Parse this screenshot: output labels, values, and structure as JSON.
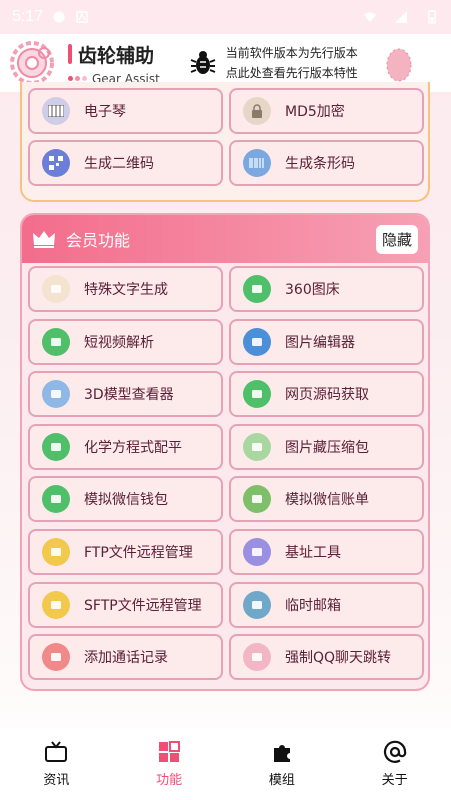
{
  "status": {
    "time": "5:17"
  },
  "header": {
    "title": "齿轮辅助",
    "subtitle": "Gear Assist",
    "notice_line1": "当前软件版本为先行版本",
    "notice_line2": "点此处查看先行版本特性"
  },
  "top_items": [
    {
      "label": "电子琴",
      "icon": "piano-icon"
    },
    {
      "label": "MD5加密",
      "icon": "lock-icon"
    },
    {
      "label": "生成二维码",
      "icon": "qrcode-icon"
    },
    {
      "label": "生成条形码",
      "icon": "barcode-icon"
    }
  ],
  "member": {
    "title": "会员功能",
    "hide_label": "隐藏",
    "items": [
      {
        "label": "特殊文字生成",
        "icon": "text-icon",
        "color": "#f3e3cf"
      },
      {
        "label": "360图床",
        "icon": "refresh-icon",
        "color": "#4fbf6a"
      },
      {
        "label": "短视频解析",
        "icon": "video-icon",
        "color": "#4fbf6a"
      },
      {
        "label": "图片编辑器",
        "icon": "folder-icon",
        "color": "#4a8fd8"
      },
      {
        "label": "3D模型查看器",
        "icon": "cube-icon",
        "color": "#8fb8e6"
      },
      {
        "label": "网页源码获取",
        "icon": "link-icon",
        "color": "#4fbf6a"
      },
      {
        "label": "化学方程式配平",
        "icon": "molecule-icon",
        "color": "#4fbf6a"
      },
      {
        "label": "图片藏压缩包",
        "icon": "archive-icon",
        "color": "#a8d8a0"
      },
      {
        "label": "模拟微信钱包",
        "icon": "wechat-icon",
        "color": "#4fbf6a"
      },
      {
        "label": "模拟微信账单",
        "icon": "yen-icon",
        "color": "#7fbf6a"
      },
      {
        "label": "FTP文件远程管理",
        "icon": "folder-icon",
        "color": "#f2c94c"
      },
      {
        "label": "基址工具",
        "icon": "bluetooth-icon",
        "color": "#9a8fe0"
      },
      {
        "label": "SFTP文件远程管理",
        "icon": "folder-icon",
        "color": "#f2c94c"
      },
      {
        "label": "临时邮箱",
        "icon": "mail-icon",
        "color": "#6fa8c8"
      },
      {
        "label": "添加通话记录",
        "icon": "edit-icon",
        "color": "#f08a8a"
      },
      {
        "label": "强制QQ聊天跳转",
        "icon": "qq-icon",
        "color": "#f2b6c4"
      }
    ]
  },
  "nav": [
    {
      "label": "资讯",
      "icon": "tv-icon"
    },
    {
      "label": "功能",
      "icon": "grid-icon"
    },
    {
      "label": "模组",
      "icon": "puzzle-icon"
    },
    {
      "label": "关于",
      "icon": "at-icon"
    }
  ]
}
